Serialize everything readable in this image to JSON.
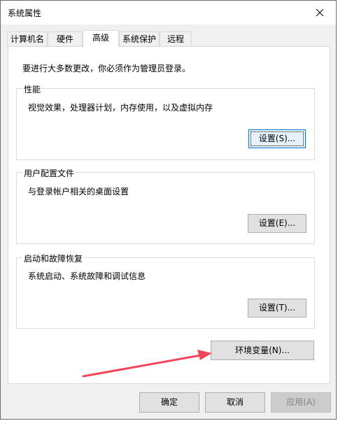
{
  "window": {
    "title": "系统属性"
  },
  "tabs": [
    "计算机名",
    "硬件",
    "高级",
    "系统保护",
    "远程"
  ],
  "active_tab_index": 2,
  "intro": "要进行大多数更改，你必须作为管理员登录。",
  "groups": {
    "performance": {
      "title": "性能",
      "description": "视觉效果，处理器计划，内存使用，以及虚拟内存",
      "button": "设置(S)..."
    },
    "user_profiles": {
      "title": "用户配置文件",
      "description": "与登录帐户相关的桌面设置",
      "button": "设置(E)..."
    },
    "startup_recovery": {
      "title": "启动和故障恢复",
      "description": "系统启动、系统故障和调试信息",
      "button": "设置(T)..."
    }
  },
  "env_button": "环境变量(N)...",
  "footer": {
    "ok": "确定",
    "cancel": "取消",
    "apply": "应用(A)"
  },
  "annotation_arrow_color": "#f0465a",
  "icons": {
    "close": "close-icon"
  }
}
